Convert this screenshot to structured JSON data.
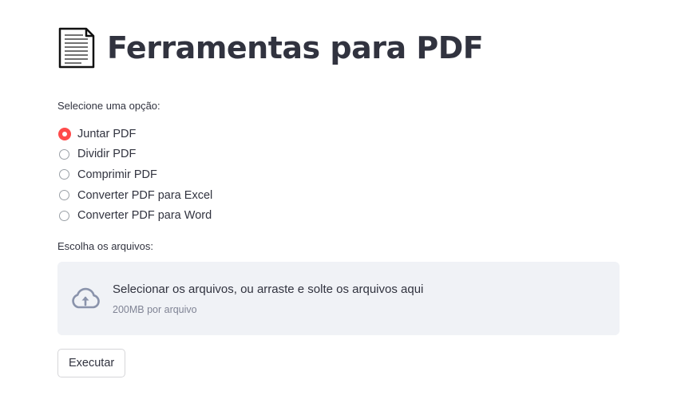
{
  "header": {
    "icon": "page-facing-up-icon",
    "title": "Ferramentas para PDF"
  },
  "options": {
    "label": "Selecione uma opção:",
    "selected_index": 0,
    "items": [
      {
        "label": "Juntar PDF"
      },
      {
        "label": "Dividir PDF"
      },
      {
        "label": "Comprimir PDF"
      },
      {
        "label": "Converter PDF para Excel"
      },
      {
        "label": "Converter PDF para Word"
      }
    ]
  },
  "uploader": {
    "label": "Escolha os arquivos:",
    "icon": "cloud-upload-icon",
    "instruction": "Selecionar os arquivos, ou arraste e solte os arquivos aqui",
    "limit": "200MB por arquivo"
  },
  "actions": {
    "execute_label": "Executar"
  },
  "colors": {
    "accent": "#ff4b4b",
    "text": "#31333f",
    "muted": "#808495",
    "dropzone_bg": "#f0f2f6"
  }
}
